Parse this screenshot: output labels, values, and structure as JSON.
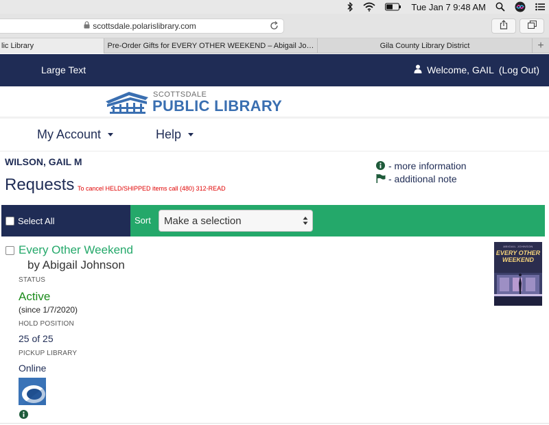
{
  "menubar": {
    "datetime": "Tue Jan 7  9:48 AM"
  },
  "browser": {
    "url": "scottsdale.polarislibrary.com",
    "tabs": [
      {
        "label": "lic Library"
      },
      {
        "label": "Pre-Order Gifts for EVERY OTHER WEEKEND – Abigail Jo…"
      },
      {
        "label": "Gila County Library District"
      }
    ],
    "new_tab_label": "+"
  },
  "header": {
    "large_text": "Large Text",
    "welcome": "Welcome, GAIL",
    "logout": "(Log Out)"
  },
  "logo": {
    "small": "SCOTTSDALE",
    "big": "PUBLIC LIBRARY"
  },
  "nav": {
    "my_account": "My Account",
    "help": "Help"
  },
  "patron_name": "WILSON, GAIL M",
  "page_title": "Requests",
  "cancel_note": "To cancel HELD/SHIPPED items call (480) 312-READ",
  "legend": {
    "info": "- more information",
    "note": "- additional note"
  },
  "sortbar": {
    "select_all": "Select All",
    "sort_label": "Sort",
    "sort_value": "Make a selection"
  },
  "item": {
    "title": "Every Other Weekend",
    "author": "by Abigail Johnson",
    "status_label": "STATUS",
    "status": "Active",
    "since": "(since 1/7/2020)",
    "hold_position_label": "HOLD POSITION",
    "hold_position": "25 of 25",
    "pickup_label": "PICKUP LIBRARY",
    "pickup": "Online",
    "cover_author": "ABIGAIL JOHNSON",
    "cover_title_1": "EVERY OTHER",
    "cover_title_2": "WEEKEND"
  },
  "colors": {
    "navy": "#1f2c55",
    "green": "#24a86a",
    "active_green": "#1b8b1b",
    "alert_red": "#e00000",
    "logo_blue": "#3a6fb1"
  }
}
